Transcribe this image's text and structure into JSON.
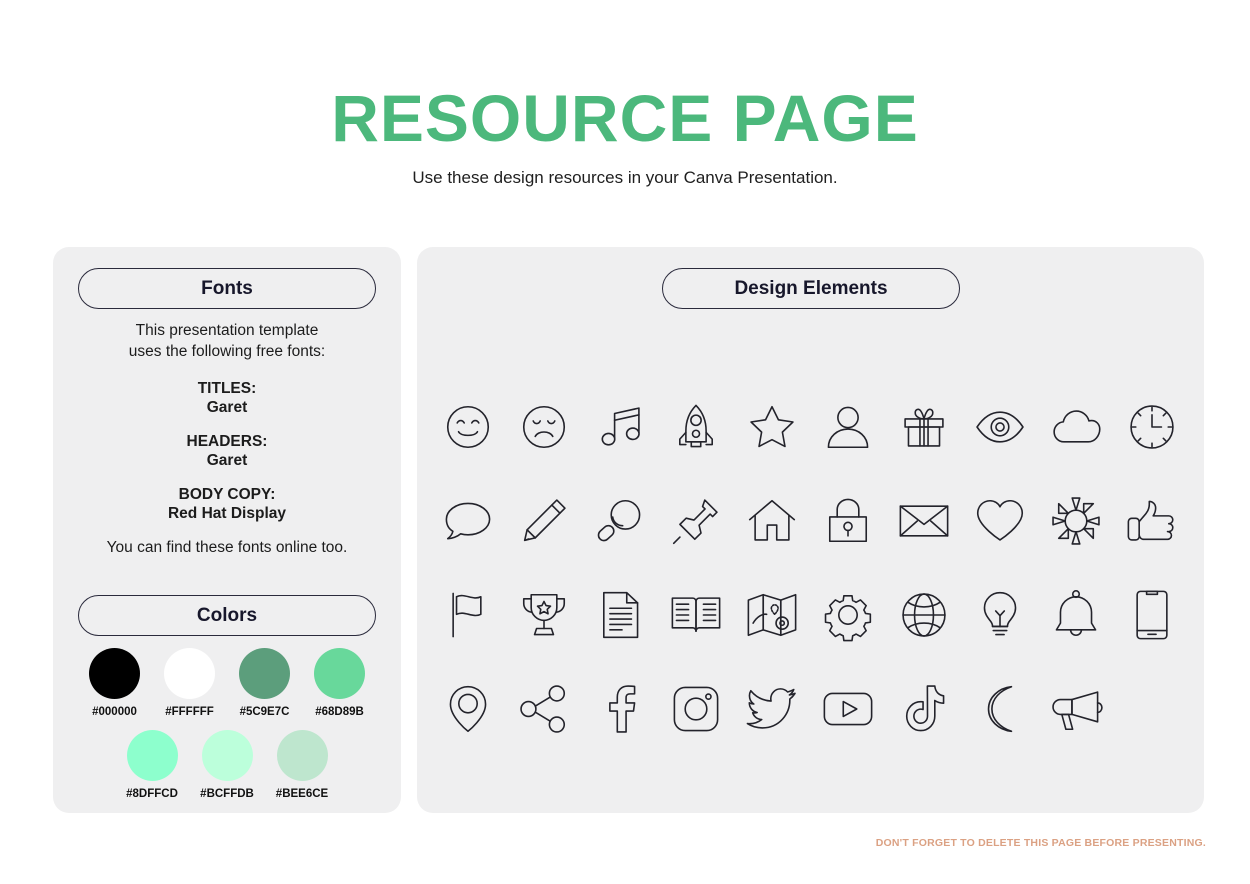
{
  "header": {
    "title": "RESOURCE PAGE",
    "subtitle": "Use these design resources in your Canva Presentation.",
    "title_color": "#4CB87C"
  },
  "fonts_panel": {
    "pill_label": "Fonts",
    "intro_line_1": "This presentation template",
    "intro_line_2": "uses the following free fonts:",
    "groups": [
      {
        "role": "TITLES:",
        "name": "Garet"
      },
      {
        "role": "HEADERS:",
        "name": "Garet"
      },
      {
        "role": "BODY COPY:",
        "name": "Red Hat Display"
      }
    ],
    "outro": "You can find these fonts online too."
  },
  "colors_panel": {
    "pill_label": "Colors",
    "row1": [
      {
        "hex": "#000000",
        "label": "#000000"
      },
      {
        "hex": "#FFFFFF",
        "label": "#FFFFFF"
      },
      {
        "hex": "#5C9E7C",
        "label": "#5C9E7C"
      },
      {
        "hex": "#68D89B",
        "label": "#68D89B"
      }
    ],
    "row2": [
      {
        "hex": "#8DFFCD",
        "label": "#8DFFCD"
      },
      {
        "hex": "#BCFFDB",
        "label": "#BCFFDB"
      },
      {
        "hex": "#BEE6CE",
        "label": "#BEE6CE"
      }
    ]
  },
  "design_panel": {
    "pill_label": "Design Elements",
    "icons": [
      "smiley-face-icon",
      "sad-face-icon",
      "music-note-icon",
      "rocket-icon",
      "star-icon",
      "person-icon",
      "gift-icon",
      "eye-icon",
      "cloud-icon",
      "clock-icon",
      "speech-bubble-icon",
      "pencil-icon",
      "magnifier-icon",
      "pushpin-icon",
      "house-icon",
      "lock-icon",
      "envelope-icon",
      "heart-icon",
      "sun-icon",
      "thumbs-up-icon",
      "flag-icon",
      "trophy-icon",
      "document-icon",
      "open-book-icon",
      "map-icon",
      "gear-icon",
      "globe-icon",
      "lightbulb-icon",
      "bell-icon",
      "phone-icon",
      "location-pin-icon",
      "share-icon",
      "facebook-icon",
      "instagram-icon",
      "twitter-icon",
      "youtube-icon",
      "tiktok-icon",
      "moon-icon",
      "megaphone-icon"
    ]
  },
  "footer": {
    "note": "DON'T FORGET TO DELETE THIS PAGE BEFORE PRESENTING.",
    "note_color": "#DBA183"
  }
}
